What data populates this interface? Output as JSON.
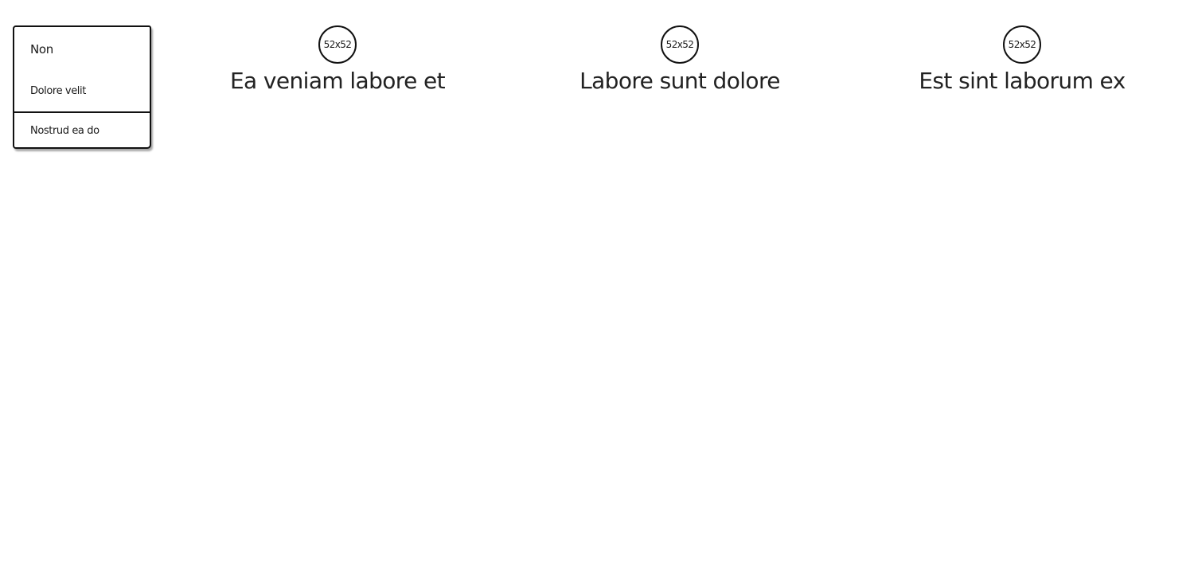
{
  "menu": {
    "items": [
      {
        "label": "Non"
      },
      {
        "label": "Dolore velit"
      },
      {
        "label": "Nostrud ea do"
      }
    ]
  },
  "features": [
    {
      "image_label": "52x52",
      "title": "Ea veniam labore et"
    },
    {
      "image_label": "52x52",
      "title": "Labore sunt dolore"
    },
    {
      "image_label": "52x52",
      "title": "Est sint laborum ex"
    }
  ]
}
